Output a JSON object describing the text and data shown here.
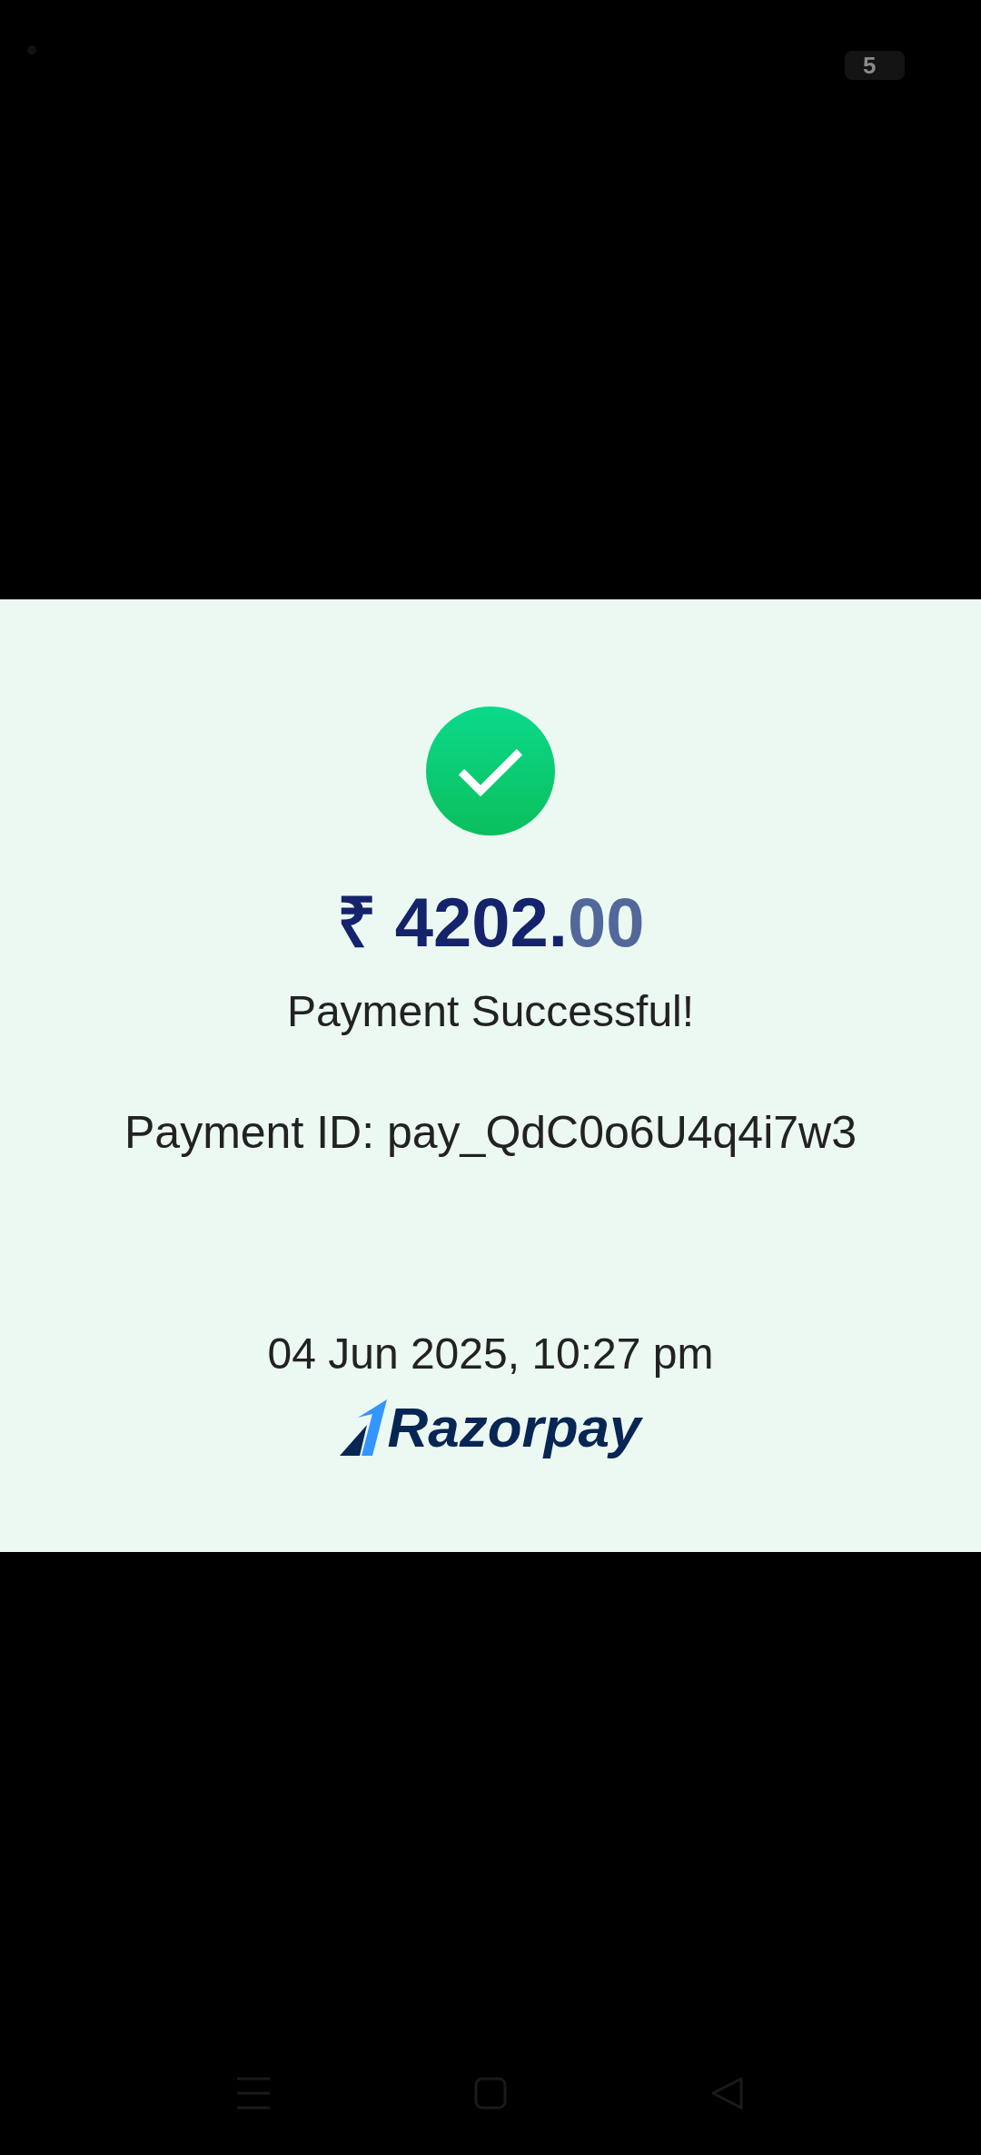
{
  "status_bar": {
    "battery_text": "5"
  },
  "receipt": {
    "success": true,
    "amount_main": "₹ 4202.",
    "amount_fraction": "00",
    "message": "Payment Successful!",
    "payment_id": "Payment ID: pay_QdC0o6U4q4i7w3",
    "datetime": "04 Jun 2025, 10:27 pm",
    "brand": "Razorpay"
  },
  "nav_bar": [
    {
      "kind": "recents"
    },
    {
      "kind": "home"
    },
    {
      "kind": "back"
    }
  ]
}
